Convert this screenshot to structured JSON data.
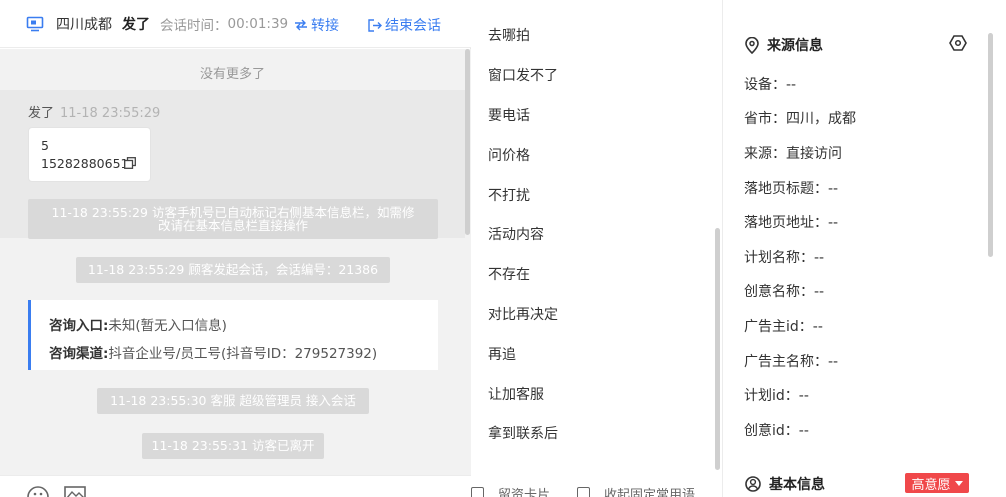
{
  "header": {
    "location": "四川成都",
    "visitor_name": "发了",
    "time_label": "会话时间：",
    "time_value": "00:01:39",
    "transfer_label": "转接",
    "end_label": "结束会话"
  },
  "chat": {
    "no_more": "没有更多了",
    "message": {
      "sender": "发了",
      "timestamp": "11-18 23:55:29",
      "lines": [
        "5",
        "15282880651"
      ]
    },
    "system_notices": [
      {
        "line1": "11-18 23:55:29 访客手机号已自动标记右侧基本信息栏，如需修",
        "line2": "改请在基本信息栏直接操作"
      },
      {
        "line1": "11-18 23:55:29 顾客发起会话，会话编号：21386"
      },
      {
        "line1": "11-18 23:55:30 客服 超级管理员 接入会话"
      },
      {
        "line1": "11-18 23:55:31 访客已离开"
      }
    ],
    "consult": {
      "entry_key": "咨询入口:",
      "entry_value": "未知(暂无入口信息)",
      "channel_key": "咨询渠道:",
      "channel_value": "抖音企业号/员工号(抖音号ID：279527392)"
    },
    "footer_icons": [
      "emoji-icon",
      "image-icon"
    ]
  },
  "phrases": {
    "items": [
      "去哪拍",
      "窗口发不了",
      "要电话",
      "问价格",
      "不打扰",
      "活动内容",
      "不存在",
      "对比再决定",
      "再追",
      "让加客服",
      "拿到联系后"
    ],
    "footer": [
      "留资卡片",
      "收起固定常用语"
    ]
  },
  "info": {
    "source_title": "来源信息",
    "fields": [
      {
        "label": "设备：",
        "value": "--"
      },
      {
        "label": "省市：",
        "value": "四川，成都"
      },
      {
        "label": "来源：",
        "value": "直接访问"
      },
      {
        "label": "落地页标题：",
        "value": "--"
      },
      {
        "label": "落地页地址：",
        "value": "--"
      },
      {
        "label": "计划名称：",
        "value": "--"
      },
      {
        "label": "创意名称：",
        "value": "--"
      },
      {
        "label": "广告主id：",
        "value": "--"
      },
      {
        "label": "广告主名称：",
        "value": "--"
      },
      {
        "label": "计划id：",
        "value": "--"
      },
      {
        "label": "创意id：",
        "value": "--"
      }
    ],
    "basic_title": "基本信息",
    "intent_tag": "高意愿"
  },
  "colors": {
    "accent": "#3a7df0",
    "tag_red": "#f0484a",
    "system_notice_bg": "#d9d9d9"
  }
}
